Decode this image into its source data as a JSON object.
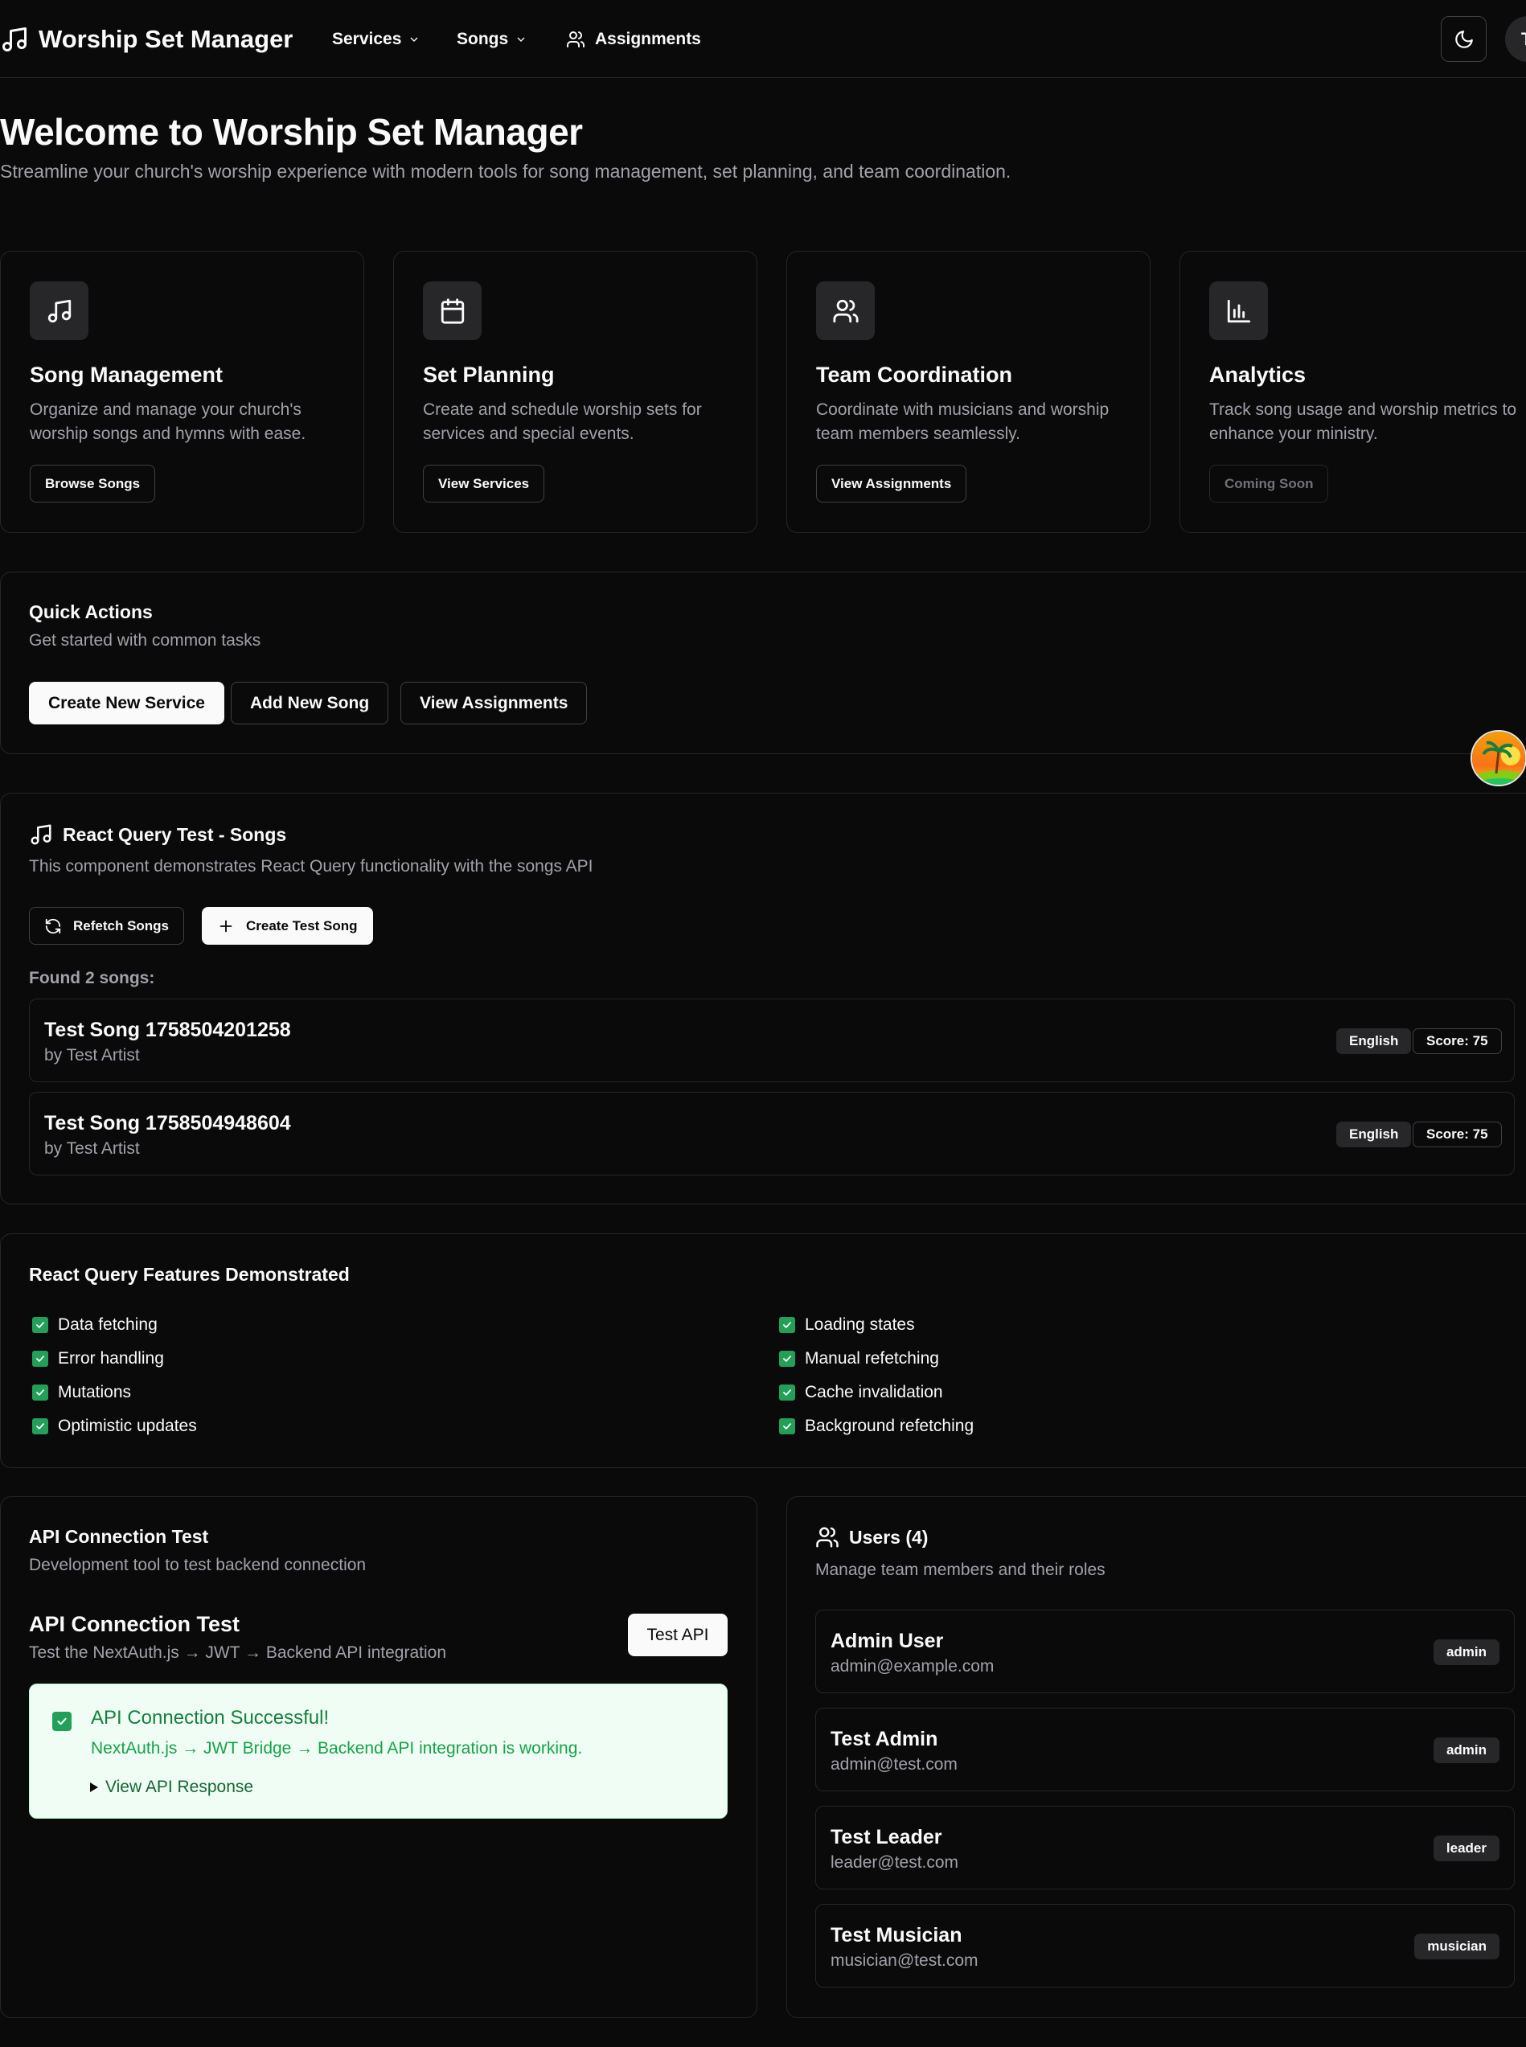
{
  "nav": {
    "brand": "Worship Set Manager",
    "items": [
      {
        "label": "Services"
      },
      {
        "label": "Songs"
      },
      {
        "label": "Assignments"
      }
    ],
    "avatar_initial": "T"
  },
  "hero": {
    "title": "Welcome to Worship Set Manager",
    "subtitle": "Streamline your church's worship experience with modern tools for song management, set planning, and team coordination."
  },
  "features": [
    {
      "icon": "music-note-icon",
      "title": "Song Management",
      "desc": "Organize and manage your church's worship songs and hymns with ease.",
      "button": "Browse Songs"
    },
    {
      "icon": "calendar-icon",
      "title": "Set Planning",
      "desc": "Create and schedule worship sets for services and special events.",
      "button": "View Services"
    },
    {
      "icon": "users-icon",
      "title": "Team Coordination",
      "desc": "Coordinate with musicians and worship team members seamlessly.",
      "button": "View Assignments"
    },
    {
      "icon": "bar-chart-icon",
      "title": "Analytics",
      "desc": "Track song usage and worship metrics to enhance your ministry.",
      "button": "Coming Soon"
    }
  ],
  "quick_actions": {
    "title": "Quick Actions",
    "subtitle": "Get started with common tasks",
    "buttons": [
      "Create New Service",
      "Add New Song",
      "View Assignments"
    ]
  },
  "react_query": {
    "title": "React Query Test - Songs",
    "subtitle": "This component demonstrates React Query functionality with the songs API",
    "refetch_label": "Refetch Songs",
    "create_label": "Create Test Song",
    "found_label": "Found 2 songs:",
    "songs": [
      {
        "title": "Test Song 1758504201258",
        "artist": "by Test Artist",
        "language": "English",
        "score": "Score: 75"
      },
      {
        "title": "Test Song 1758504948604",
        "artist": "by Test Artist",
        "language": "English",
        "score": "Score: 75"
      }
    ]
  },
  "features_demo": {
    "title": "React Query Features Demonstrated",
    "left": [
      "Data fetching",
      "Error handling",
      "Mutations",
      "Optimistic updates"
    ],
    "right": [
      "Loading states",
      "Manual refetching",
      "Cache invalidation",
      "Background refetching"
    ]
  },
  "api_test": {
    "card_title": "API Connection Test",
    "card_subtitle": "Development tool to test backend connection",
    "heading": "API Connection Test",
    "desc": "Test the NextAuth.js → JWT → Backend API integration",
    "button": "Test API",
    "success_title": "API Connection Successful!",
    "success_desc": "NextAuth.js → JWT Bridge → Backend API integration is working.",
    "view_response": "View API Response"
  },
  "users": {
    "title": "Users (4)",
    "subtitle": "Manage team members and their roles",
    "list": [
      {
        "name": "Admin User",
        "email": "admin@example.com",
        "role": "admin"
      },
      {
        "name": "Test Admin",
        "email": "admin@test.com",
        "role": "admin"
      },
      {
        "name": "Test Leader",
        "email": "leader@test.com",
        "role": "leader"
      },
      {
        "name": "Test Musician",
        "email": "musician@test.com",
        "role": "musician"
      }
    ]
  },
  "colors": {
    "background": "#0a0a0a",
    "success": "#22a05a",
    "success_bg": "#f0fdf4"
  }
}
